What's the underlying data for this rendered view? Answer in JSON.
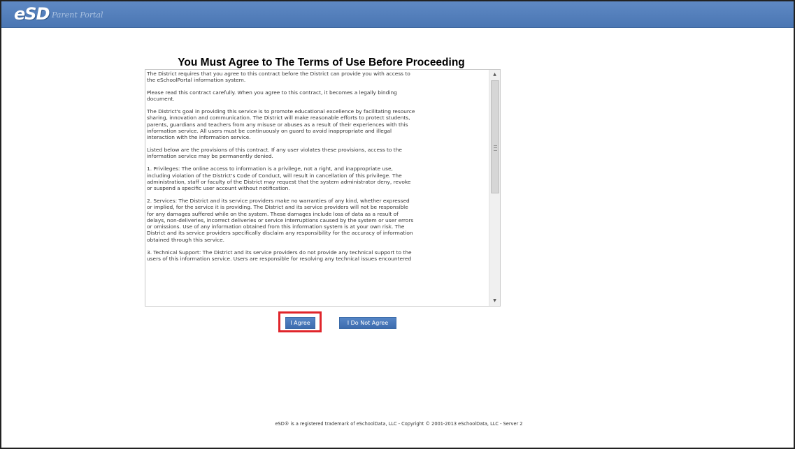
{
  "header": {
    "logo_text": "eSD",
    "portal_name": "Parent Portal",
    "color": "#4f7bb8"
  },
  "main": {
    "title": "You Must Agree to The Terms of Use Before Proceeding",
    "terms_paragraphs": [
      "The District requires that you agree to this contract before the District can provide you with access to\nthe eSchoolPortal information system.",
      "Please read this contract carefully. When you agree to this contract, it becomes a legally binding\ndocument.",
      "The District's goal in providing this service is to promote educational excellence by facilitating resource\nsharing, innovation and communication.  The District will make reasonable efforts to protect students,\nparents, guardians and teachers from any misuse or abuses as a result of their experiences with this\ninformation service.  All users must be continuously on guard to avoid inappropriate and illegal\ninteraction with the information service.",
      "Listed below are the provisions of this contract.  If any user violates these provisions, access to the\ninformation service may be permanently denied.",
      "1. Privileges: The online access to information is a privilege, not a right, and inappropriate use,\nincluding violation of the District's Code of Conduct, will result in cancellation of this privilege.  The\nadministration, staff or faculty of the District may request that the system administrator deny, revoke\nor suspend a specific user account without notification.",
      "2. Services: The District and its service providers make no warranties of any kind, whether expressed\nor implied, for the service it is providing.  The District and its service providers will not be responsible\nfor any damages suffered while on the system. These damages include loss of data as a result of\ndelays, non-deliveries, incorrect deliveries or service interruptions caused by the system or user errors\nor omissions.  Use of any information obtained from this information system is at your own risk.  The\nDistrict and its service providers specifically disclaim any responsibility for the accuracy of information\nobtained through this service.",
      "3. Technical Support: The District and its service providers do not provide any technical support to the\nusers of this information service.  Users are responsible for resolving any technical issues encountered"
    ],
    "agree_label": "I Agree",
    "disagree_label": "I Do Not Agree",
    "highlight_color": "#e0252b"
  },
  "footer": {
    "text": "eSD® is a registered trademark of eSchoolData, LLC - Copyright © 2001-2013 eSchoolData, LLC - Server 2"
  }
}
